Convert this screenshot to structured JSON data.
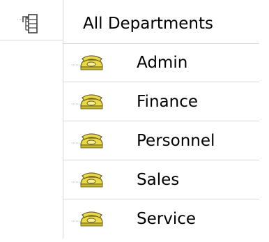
{
  "tree": {
    "root": {
      "label": "All Departments",
      "icon": "org-chart-icon"
    },
    "children": [
      {
        "label": "Admin",
        "icon": "telephone-icon"
      },
      {
        "label": "Finance",
        "icon": "telephone-icon"
      },
      {
        "label": "Personnel",
        "icon": "telephone-icon"
      },
      {
        "label": "Sales",
        "icon": "telephone-icon"
      },
      {
        "label": "Service",
        "icon": "telephone-icon"
      }
    ]
  },
  "colors": {
    "grid_line": "#d9d9d9",
    "phone_yellow": "#e8d84a",
    "phone_outline": "#6b6220",
    "icon_gray": "#4a4a4a"
  }
}
